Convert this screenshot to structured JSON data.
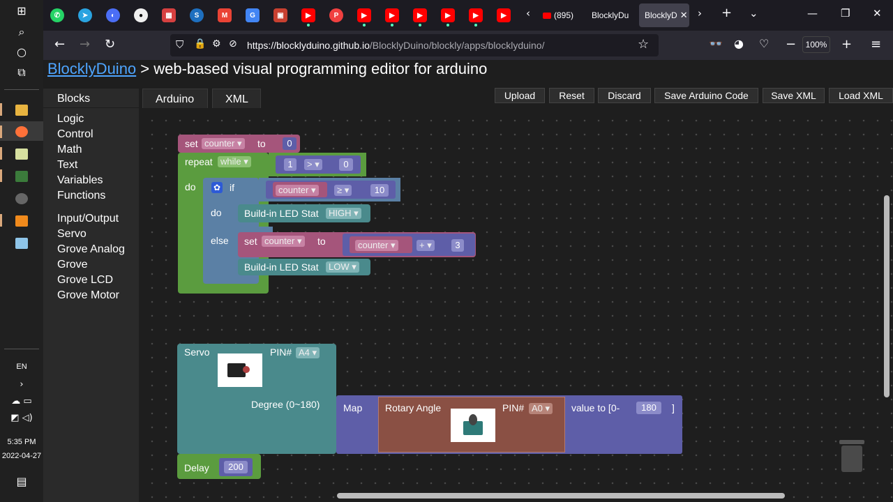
{
  "taskbar": {
    "language": "EN",
    "time": "5:35 PM",
    "date": "2022-04-27"
  },
  "browser": {
    "tabs": [
      {
        "label": "(895)",
        "active": false
      },
      {
        "label": "BlocklyDu",
        "active": false
      },
      {
        "label": "BlocklyD",
        "active": true
      }
    ],
    "url_host": "https://blocklyduino.github.io",
    "url_path": "/BlocklyDuino/blockly/apps/blocklyduino/",
    "zoom": "100%"
  },
  "page": {
    "title_link": "BlocklyDuino",
    "title_rest": " > web-based visual programming editor for arduino",
    "sidebar_header": "Blocks",
    "categories": [
      "Logic",
      "Control",
      "Math",
      "Text",
      "Variables",
      "Functions",
      "Input/Output",
      "Servo",
      "Grove Analog",
      "Grove",
      "Grove LCD",
      "Grove Motor"
    ],
    "code_tabs": [
      "Arduino",
      "XML"
    ],
    "actions": [
      "Upload",
      "Reset",
      "Discard",
      "Save Arduino Code",
      "Save XML",
      "Load XML"
    ]
  },
  "blocks": {
    "set1": {
      "set": "set",
      "var": "counter",
      "to": "to",
      "value": "0"
    },
    "repeat": {
      "label": "repeat",
      "mode": "while",
      "do": "do",
      "left": "1",
      "op": ">",
      "right": "0"
    },
    "ifelse": {
      "if": "if",
      "var": "counter",
      "op": "≥",
      "value": "10",
      "do": "do",
      "else": "else"
    },
    "led_high": {
      "label": "Build-in LED Stat",
      "state": "HIGH"
    },
    "set2": {
      "set": "set",
      "var": "counter",
      "to": "to",
      "var2": "counter",
      "op": "+",
      "value": "3"
    },
    "led_low": {
      "label": "Build-in LED Stat",
      "state": "LOW"
    },
    "servo": {
      "label": "Servo",
      "pin_label": "PIN#",
      "pin": "A4",
      "degree": "Degree (0~180)"
    },
    "map": {
      "label": "Map",
      "sensor": "Rotary Angle",
      "pin_label": "PIN#",
      "pin": "A0",
      "value_to": "value to [0-",
      "max": "180",
      "close": "]"
    },
    "delay": {
      "label": "Delay",
      "value": "200"
    }
  }
}
